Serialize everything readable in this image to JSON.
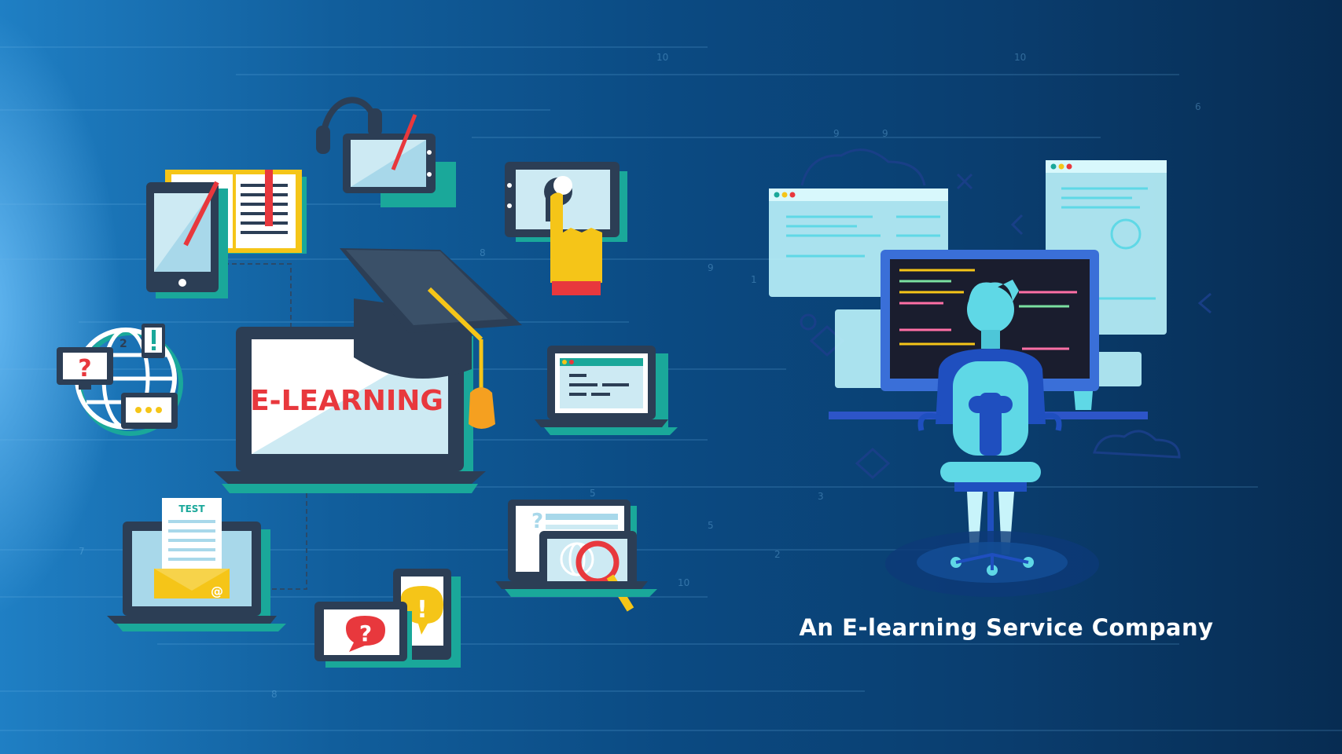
{
  "laptop": {
    "screen_text": "E-LEARNING"
  },
  "test_sheet": {
    "label": "TEST"
  },
  "email": {
    "symbol": "@"
  },
  "globe": {
    "badge_number": "2"
  },
  "headline": {
    "text": "An E-learning Service Company"
  },
  "icons": [
    "graduation-cap-icon",
    "book-icon",
    "tablet-pencil-icon",
    "headphones-icon",
    "head-click-icon",
    "globe-network-icon",
    "code-window-icon",
    "test-envelope-icon",
    "question-chat-icon",
    "magnifier-icon",
    "developer-at-desk-icon"
  ],
  "colors": {
    "background_dark": "#072c52",
    "background_light": "#1f7fc4",
    "accent_teal": "#1aa89a",
    "accent_red": "#e8383d",
    "accent_yellow": "#f5c518",
    "device_dark": "#2c3e55",
    "screen_light": "#d6ecf7"
  }
}
